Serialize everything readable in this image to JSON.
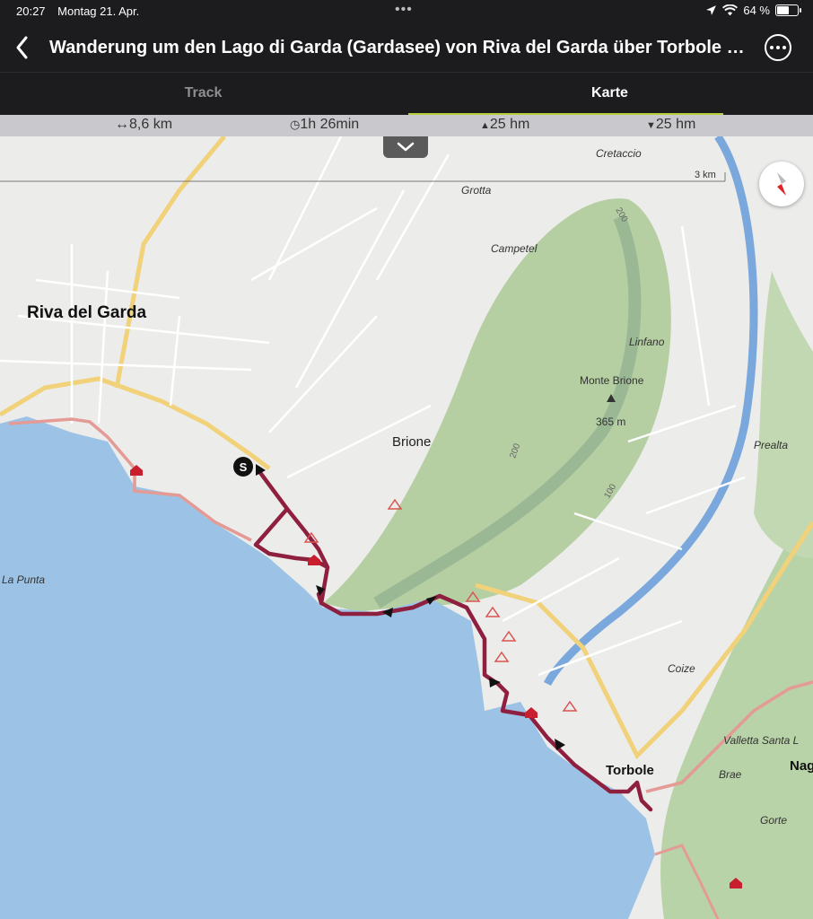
{
  "status_bar": {
    "time": "20:27",
    "date": "Montag 21. Apr.",
    "battery_percent": "64 %",
    "battery_level": 0.64,
    "icons": [
      "location-arrow-icon",
      "wifi-icon",
      "battery-icon"
    ]
  },
  "header": {
    "title": "Wanderung um den Lago di Garda (Gardasee) von Riva del Garda über Torbole a...",
    "back_icon": "chevron-left-icon",
    "more_icon": "ellipsis-circle-icon"
  },
  "tabs": [
    {
      "label": "Track",
      "active": false
    },
    {
      "label": "Karte",
      "active": true
    }
  ],
  "stats": {
    "distance": "8,6 km",
    "duration": "1h 26min",
    "ascent": "25 hm",
    "descent": "25 hm"
  },
  "map": {
    "scale_label": "3 km",
    "start_marker": "S",
    "labels": {
      "riva": "Riva del Garda",
      "brione": "Brione",
      "torbole": "Torbole",
      "nago": "Nag",
      "cretaccio": "Cretaccio",
      "grotta": "Grotta",
      "campetel": "Campetel",
      "linfano": "Linfano",
      "monte_brione": "Monte Brione",
      "summit_elev": "365 m",
      "prealta": "Prealta",
      "coize": "Coize",
      "valletta": "Valletta Santa L",
      "brae": "Brae",
      "gorte": "Gorte",
      "la_punta": "La Punta",
      "contour_200a": "200",
      "contour_200b": "200",
      "contour_100": "100"
    },
    "colors": {
      "lake": "#9cc3e6",
      "track": "#8f1f3f",
      "land": "#ececeb",
      "forest": "#a9c99a",
      "road_major": "#f1d27a",
      "cycle_path": "#e49a95",
      "river": "#7aa8dc"
    }
  }
}
